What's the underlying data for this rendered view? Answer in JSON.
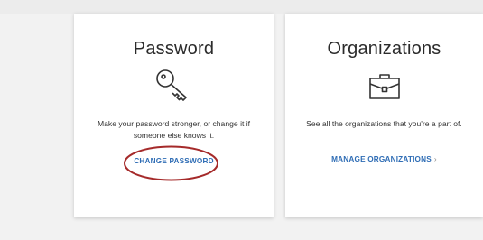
{
  "cards": {
    "password": {
      "title": "Password",
      "icon": "key-icon",
      "description": "Make your password stronger, or change it if someone else knows it.",
      "link_label": "CHANGE PASSWORD"
    },
    "organizations": {
      "title": "Organizations",
      "icon": "briefcase-icon",
      "description": "See all the organizations that you're a part of.",
      "link_label": "MANAGE ORGANIZATIONS",
      "link_chevron": "›"
    }
  },
  "colors": {
    "link": "#2f6db5",
    "annotation": "#a52a2a",
    "background": "#f2f2f2"
  }
}
